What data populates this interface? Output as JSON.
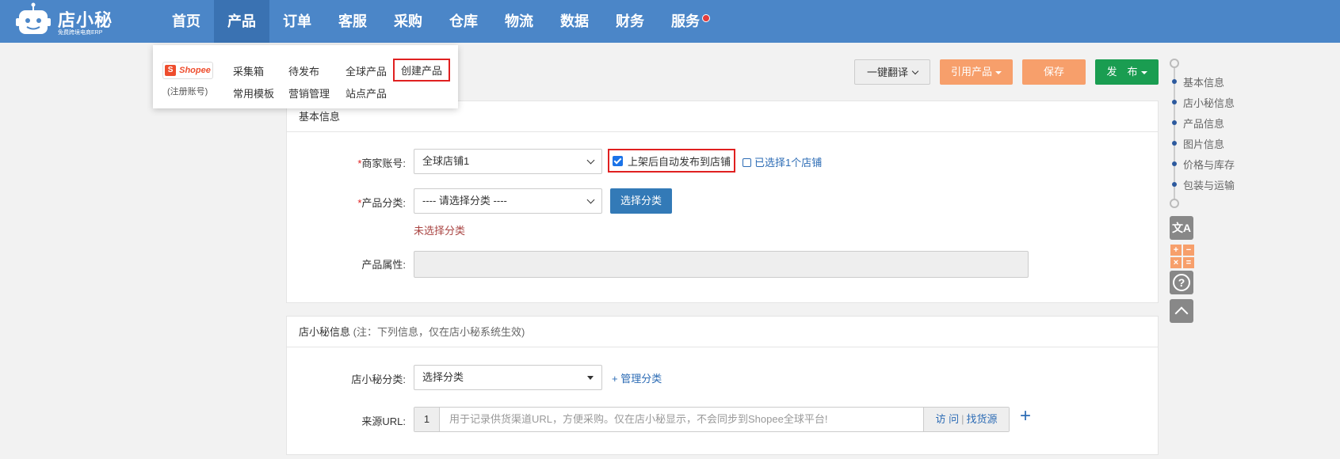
{
  "brand": {
    "name": "店小秘",
    "tagline": "免费跨境电商ERP"
  },
  "nav": {
    "items": [
      {
        "label": "首页"
      },
      {
        "label": "产品"
      },
      {
        "label": "订单"
      },
      {
        "label": "客服"
      },
      {
        "label": "采购"
      },
      {
        "label": "仓库"
      },
      {
        "label": "物流"
      },
      {
        "label": "数据"
      },
      {
        "label": "财务"
      },
      {
        "label": "服务"
      }
    ],
    "active_index": 1
  },
  "product_menu": {
    "platform": "Shopee",
    "register": "(注册账号)",
    "links": [
      "采集箱",
      "待发布",
      "全球产品",
      "创建产品",
      "常用模板",
      "营销管理",
      "站点产品"
    ]
  },
  "toolbar": {
    "translate": "一键翻译",
    "quote": "引用产品",
    "save": "保存",
    "publish": "发　布"
  },
  "basic_info": {
    "title": "基本信息",
    "merchant_label": "商家账号:",
    "merchant_value": "全球店铺1",
    "auto_publish": "上架后自动发布到店铺",
    "selected_shops": "已选择1个店铺",
    "category_label": "产品分类:",
    "category_value": "---- 请选择分类 ----",
    "choose_category": "选择分类",
    "category_error": "未选择分类",
    "attr_label": "产品属性:",
    "required_mark": "*"
  },
  "dxm_info": {
    "title": "店小秘信息",
    "note": "(注：下列信息，仅在店小秘系统生效)",
    "category_label": "店小秘分类:",
    "category_value": "选择分类",
    "manage_category": "+ 管理分类",
    "url_label": "来源URL:",
    "url_index": "1",
    "url_placeholder": "用于记录供货渠道URL，方便采购。仅在店小秘显示，不会同步到Shopee全球平台!",
    "visit": "访 问",
    "find_source": "找货源",
    "add": "+"
  },
  "right_nav": {
    "items": [
      "基本信息",
      "店小秘信息",
      "产品信息",
      "图片信息",
      "价格与库存",
      "包装与运输"
    ]
  },
  "side_tools": {
    "translate_glyph": "文A",
    "calc": [
      "+",
      "−",
      "×",
      "="
    ],
    "help": "?"
  }
}
